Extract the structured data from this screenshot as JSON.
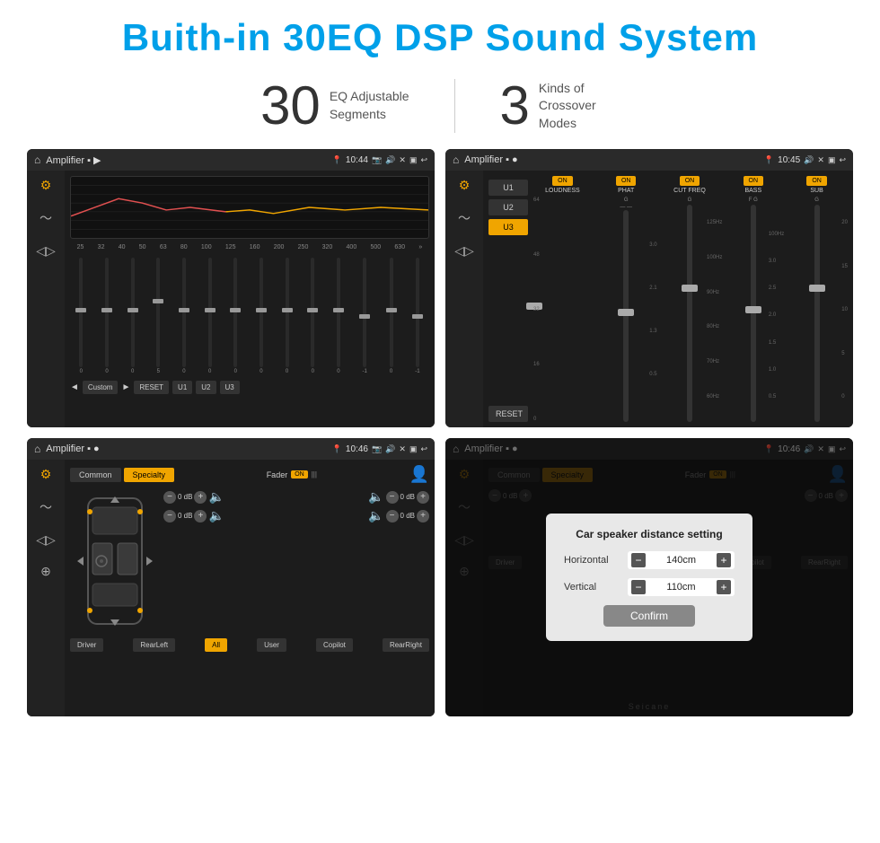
{
  "header": {
    "title": "Buith-in 30EQ DSP Sound System"
  },
  "stats": [
    {
      "number": "30",
      "label": "EQ Adjustable\nSegments"
    },
    {
      "number": "3",
      "label": "Kinds of\nCrossover Modes"
    }
  ],
  "screens": {
    "eq_screen": {
      "title": "Amplifier",
      "time": "10:44",
      "freq_labels": [
        "25",
        "32",
        "40",
        "50",
        "63",
        "80",
        "100",
        "125",
        "160",
        "200",
        "250",
        "320",
        "400",
        "500",
        "630"
      ],
      "sliders": [
        0,
        0,
        0,
        5,
        0,
        0,
        0,
        0,
        0,
        0,
        0,
        "-1",
        0,
        "-1"
      ],
      "bottom_buttons": [
        "◄",
        "Custom",
        "►",
        "RESET",
        "U1",
        "U2",
        "U3"
      ]
    },
    "crossover_screen": {
      "title": "Amplifier",
      "time": "10:45",
      "presets": [
        "U1",
        "U2",
        "U3"
      ],
      "active_preset": "U3",
      "channels": [
        "LOUDNESS",
        "PHAT",
        "CUT FREQ",
        "BASS",
        "SUB"
      ],
      "reset_label": "RESET"
    },
    "specialty_screen": {
      "title": "Amplifier",
      "time": "10:46",
      "tabs": [
        "Common",
        "Specialty"
      ],
      "active_tab": "Specialty",
      "fader_label": "Fader",
      "fader_on": "ON",
      "speaker_rows": {
        "top_left": "0 dB",
        "top_right": "0 dB",
        "bottom_left": "0 dB",
        "bottom_right": "0 dB"
      },
      "bottom_buttons": [
        "Driver",
        "RearLeft",
        "All",
        "User",
        "Copilot",
        "RearRight"
      ]
    },
    "dialog_screen": {
      "title": "Amplifier",
      "time": "10:46",
      "dialog": {
        "title": "Car speaker distance setting",
        "horizontal_label": "Horizontal",
        "horizontal_value": "140cm",
        "vertical_label": "Vertical",
        "vertical_value": "110cm",
        "confirm_label": "Confirm"
      }
    }
  },
  "watermark": "Seicane"
}
